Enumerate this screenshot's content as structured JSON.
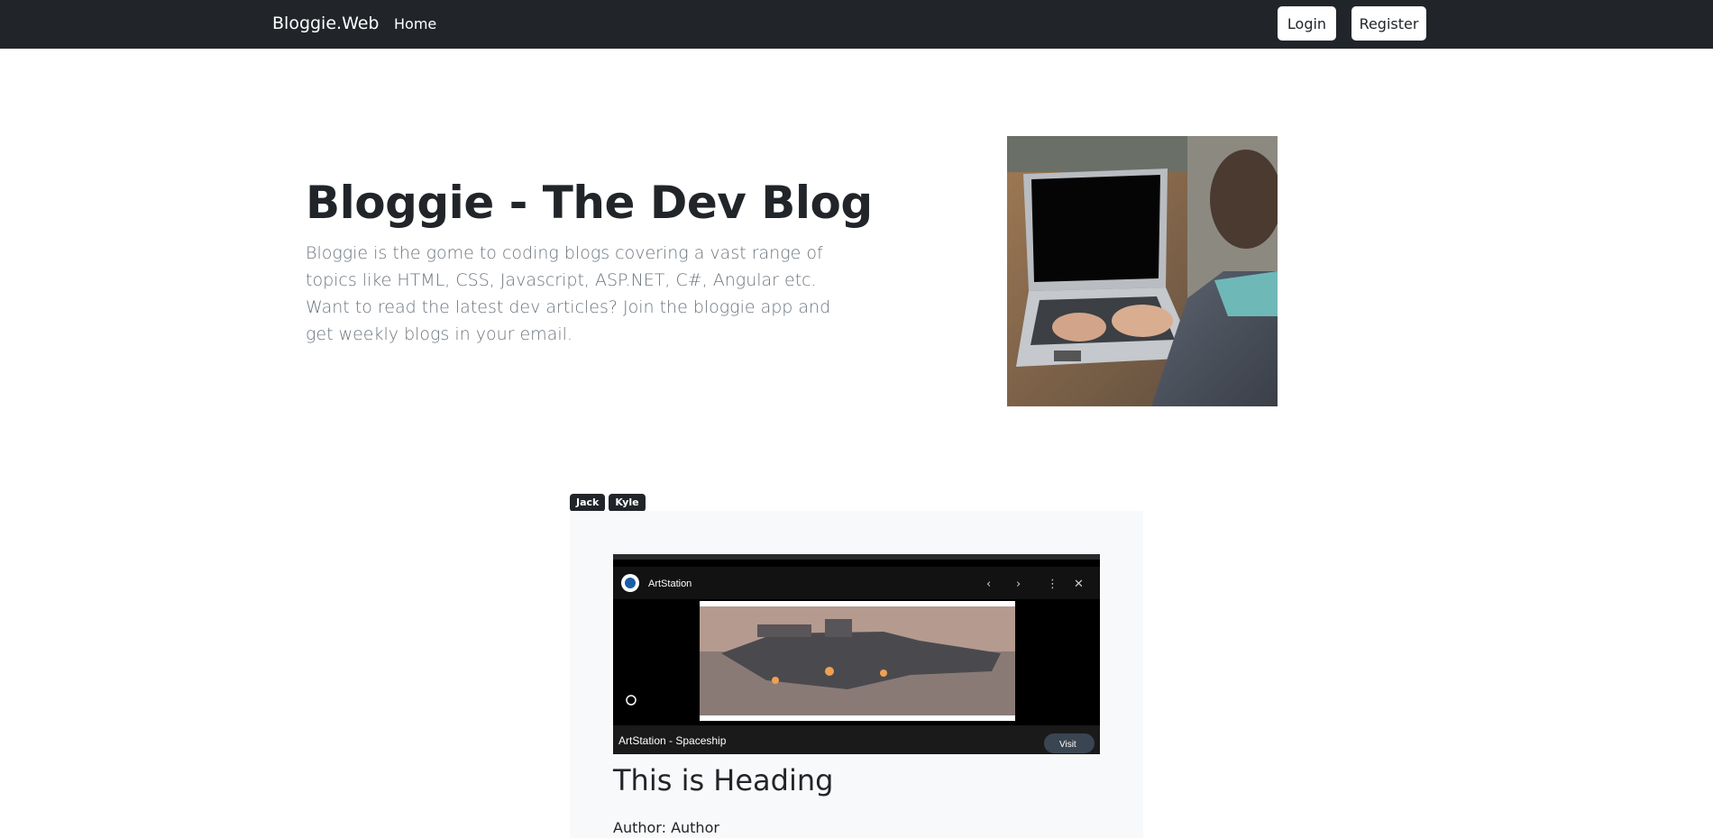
{
  "navbar": {
    "brand": "Bloggie.Web",
    "links": [
      {
        "label": "Home"
      }
    ],
    "login_label": "Login",
    "register_label": "Register"
  },
  "hero": {
    "title": "Bloggie - The Dev Blog",
    "description": "Bloggie is the gome to coding blogs covering a vast range of topics like HTML, CSS, Javascript, ASP.NET, C#, Angular etc. Want to read the latest dev articles? Join the bloggie app and get weekly blogs in your email."
  },
  "post": {
    "tags": [
      "Jack",
      "Kyle"
    ],
    "image": {
      "source_name": "ArtStation",
      "caption": "ArtStation - Spaceship",
      "visit_label": "Visit"
    },
    "heading": "This is Heading",
    "author_label": "Author: Author"
  }
}
